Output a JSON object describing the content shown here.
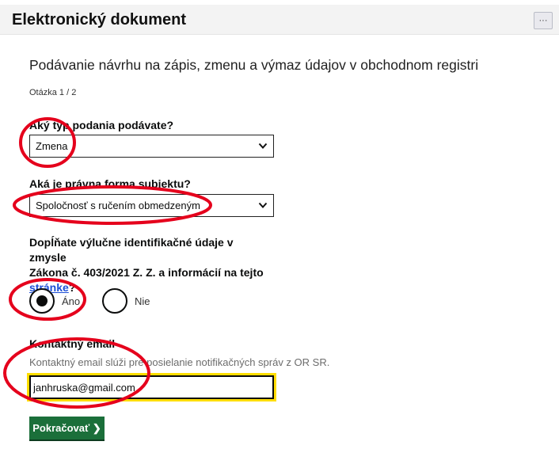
{
  "header": {
    "title": "Elektronický dokument",
    "more_label": "···"
  },
  "form": {
    "title": "Podávanie návrhu na zápis, zmenu a výmaz údajov v obchodnom registri",
    "step": "Otázka 1 / 2",
    "submission_type": {
      "label": "Aký typ podania podávate?",
      "value": "Zmena"
    },
    "legal_form": {
      "label": "Aká je právna forma subjektu?",
      "value": "Spoločnosť s ručením obmedzeným"
    },
    "identification": {
      "line1": "Dopĺňate výlučne identifikačné údaje v zmysle",
      "line2": "Zákona č. 403/2021 Z. Z. a informácií na tejto",
      "link": "stránke",
      "suffix": "?",
      "options": {
        "yes": "Áno",
        "no": "Nie"
      },
      "selected": "yes"
    },
    "email": {
      "label": "Kontaktný email",
      "hint": "Kontaktný email slúži pre posielanie notifikačných správ z OR SR.",
      "value": "janhruska@gmail.com"
    },
    "submit_label": "Pokračovať ❯"
  },
  "annotations": {
    "color": "#e5001c"
  }
}
